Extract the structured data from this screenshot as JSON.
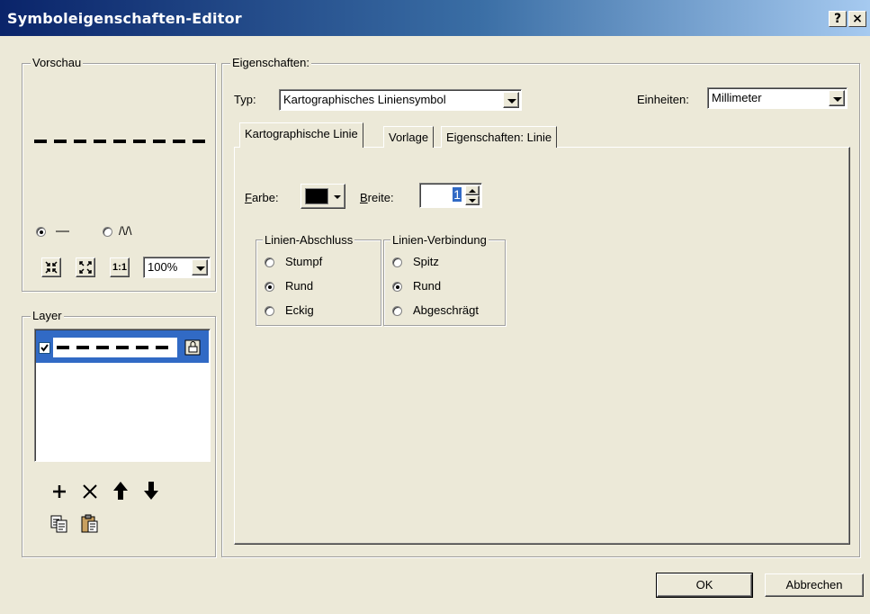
{
  "window": {
    "title": "Symboleigenschaften-Editor",
    "help_button": "?",
    "close_button": "×"
  },
  "preview": {
    "group_label": "Vorschau",
    "radio_line": "—",
    "radio_wave": "/\\/\\",
    "zoom_value": "100%",
    "btn_fit_label": "1:1"
  },
  "layer": {
    "group_label": "Layer",
    "checked": true
  },
  "properties": {
    "group_label": "Eigenschaften:",
    "type_label": "Typ:",
    "type_value": "Kartographisches Liniensymbol",
    "units_label": "Einheiten:",
    "units_value": "Millimeter"
  },
  "tabs": [
    {
      "label": "Kartographische Linie",
      "active": true
    },
    {
      "label": "Vorlage",
      "active": false
    },
    {
      "label": "Eigenschaften: Linie",
      "active": false
    }
  ],
  "line": {
    "color_label_prefix": "",
    "color_label_accel": "F",
    "color_label_rest": "arbe:",
    "color_value": "#000000",
    "width_label_accel": "B",
    "width_label_rest": "reite:",
    "width_value": "1"
  },
  "cap": {
    "label": "Linien-Abschluss",
    "options": [
      {
        "label": "Stumpf",
        "checked": false
      },
      {
        "label": "Rund",
        "checked": true
      },
      {
        "label": "Eckig",
        "checked": false
      }
    ]
  },
  "join": {
    "label": "Linien-Verbindung",
    "options": [
      {
        "label": "Spitz",
        "checked": false
      },
      {
        "label": "Rund",
        "checked": true
      },
      {
        "label": "Abgeschrägt",
        "checked": false
      }
    ]
  },
  "buttons": {
    "ok": "OK",
    "cancel": "Abbrechen"
  },
  "colors": {
    "titlebar_start": "#0a246a",
    "titlebar_end": "#a6caf0",
    "selection": "#316ac5",
    "face": "#ece9d8"
  }
}
